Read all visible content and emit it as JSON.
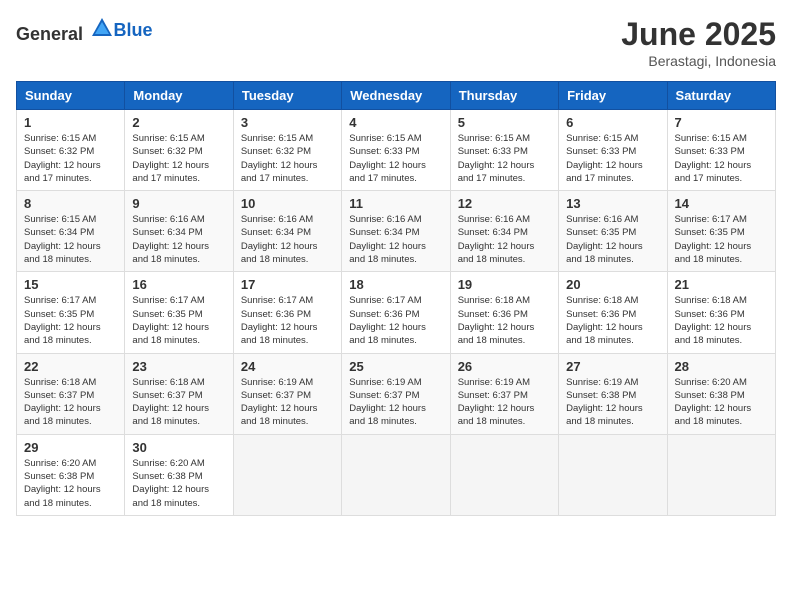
{
  "logo": {
    "general": "General",
    "blue": "Blue"
  },
  "title": "June 2025",
  "location": "Berastagi, Indonesia",
  "days_header": [
    "Sunday",
    "Monday",
    "Tuesday",
    "Wednesday",
    "Thursday",
    "Friday",
    "Saturday"
  ],
  "weeks": [
    [
      {
        "day": "1",
        "sunrise": "6:15 AM",
        "sunset": "6:32 PM",
        "daylight": "12 hours and 17 minutes."
      },
      {
        "day": "2",
        "sunrise": "6:15 AM",
        "sunset": "6:32 PM",
        "daylight": "12 hours and 17 minutes."
      },
      {
        "day": "3",
        "sunrise": "6:15 AM",
        "sunset": "6:32 PM",
        "daylight": "12 hours and 17 minutes."
      },
      {
        "day": "4",
        "sunrise": "6:15 AM",
        "sunset": "6:33 PM",
        "daylight": "12 hours and 17 minutes."
      },
      {
        "day": "5",
        "sunrise": "6:15 AM",
        "sunset": "6:33 PM",
        "daylight": "12 hours and 17 minutes."
      },
      {
        "day": "6",
        "sunrise": "6:15 AM",
        "sunset": "6:33 PM",
        "daylight": "12 hours and 17 minutes."
      },
      {
        "day": "7",
        "sunrise": "6:15 AM",
        "sunset": "6:33 PM",
        "daylight": "12 hours and 17 minutes."
      }
    ],
    [
      {
        "day": "8",
        "sunrise": "6:15 AM",
        "sunset": "6:34 PM",
        "daylight": "12 hours and 18 minutes."
      },
      {
        "day": "9",
        "sunrise": "6:16 AM",
        "sunset": "6:34 PM",
        "daylight": "12 hours and 18 minutes."
      },
      {
        "day": "10",
        "sunrise": "6:16 AM",
        "sunset": "6:34 PM",
        "daylight": "12 hours and 18 minutes."
      },
      {
        "day": "11",
        "sunrise": "6:16 AM",
        "sunset": "6:34 PM",
        "daylight": "12 hours and 18 minutes."
      },
      {
        "day": "12",
        "sunrise": "6:16 AM",
        "sunset": "6:34 PM",
        "daylight": "12 hours and 18 minutes."
      },
      {
        "day": "13",
        "sunrise": "6:16 AM",
        "sunset": "6:35 PM",
        "daylight": "12 hours and 18 minutes."
      },
      {
        "day": "14",
        "sunrise": "6:17 AM",
        "sunset": "6:35 PM",
        "daylight": "12 hours and 18 minutes."
      }
    ],
    [
      {
        "day": "15",
        "sunrise": "6:17 AM",
        "sunset": "6:35 PM",
        "daylight": "12 hours and 18 minutes."
      },
      {
        "day": "16",
        "sunrise": "6:17 AM",
        "sunset": "6:35 PM",
        "daylight": "12 hours and 18 minutes."
      },
      {
        "day": "17",
        "sunrise": "6:17 AM",
        "sunset": "6:36 PM",
        "daylight": "12 hours and 18 minutes."
      },
      {
        "day": "18",
        "sunrise": "6:17 AM",
        "sunset": "6:36 PM",
        "daylight": "12 hours and 18 minutes."
      },
      {
        "day": "19",
        "sunrise": "6:18 AM",
        "sunset": "6:36 PM",
        "daylight": "12 hours and 18 minutes."
      },
      {
        "day": "20",
        "sunrise": "6:18 AM",
        "sunset": "6:36 PM",
        "daylight": "12 hours and 18 minutes."
      },
      {
        "day": "21",
        "sunrise": "6:18 AM",
        "sunset": "6:36 PM",
        "daylight": "12 hours and 18 minutes."
      }
    ],
    [
      {
        "day": "22",
        "sunrise": "6:18 AM",
        "sunset": "6:37 PM",
        "daylight": "12 hours and 18 minutes."
      },
      {
        "day": "23",
        "sunrise": "6:18 AM",
        "sunset": "6:37 PM",
        "daylight": "12 hours and 18 minutes."
      },
      {
        "day": "24",
        "sunrise": "6:19 AM",
        "sunset": "6:37 PM",
        "daylight": "12 hours and 18 minutes."
      },
      {
        "day": "25",
        "sunrise": "6:19 AM",
        "sunset": "6:37 PM",
        "daylight": "12 hours and 18 minutes."
      },
      {
        "day": "26",
        "sunrise": "6:19 AM",
        "sunset": "6:37 PM",
        "daylight": "12 hours and 18 minutes."
      },
      {
        "day": "27",
        "sunrise": "6:19 AM",
        "sunset": "6:38 PM",
        "daylight": "12 hours and 18 minutes."
      },
      {
        "day": "28",
        "sunrise": "6:20 AM",
        "sunset": "6:38 PM",
        "daylight": "12 hours and 18 minutes."
      }
    ],
    [
      {
        "day": "29",
        "sunrise": "6:20 AM",
        "sunset": "6:38 PM",
        "daylight": "12 hours and 18 minutes."
      },
      {
        "day": "30",
        "sunrise": "6:20 AM",
        "sunset": "6:38 PM",
        "daylight": "12 hours and 18 minutes."
      },
      null,
      null,
      null,
      null,
      null
    ]
  ],
  "labels": {
    "sunrise": "Sunrise:",
    "sunset": "Sunset:",
    "daylight": "Daylight:"
  }
}
